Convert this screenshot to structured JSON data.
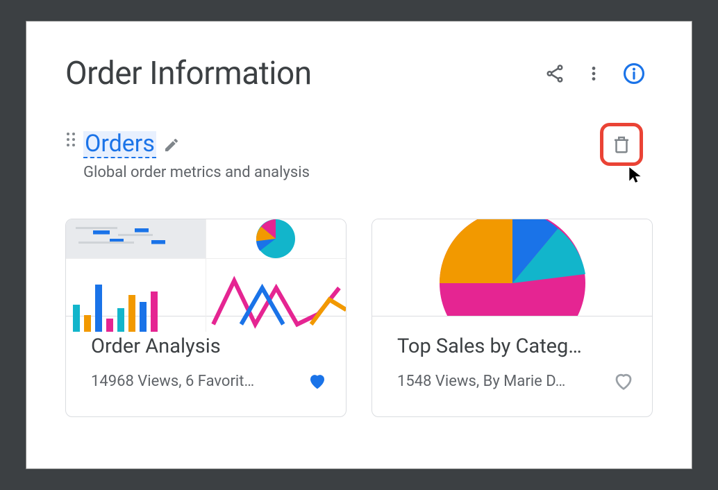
{
  "header": {
    "title": "Order Information",
    "icons": {
      "share": "share-icon",
      "more": "more-vert-icon",
      "info": "info-icon"
    }
  },
  "section": {
    "title": "Orders",
    "description": "Global order metrics and analysis",
    "delete_icon": "delete-icon",
    "edit_icon": "pencil-icon",
    "drag_icon": "drag-handle-icon"
  },
  "cards": [
    {
      "title": "Order Analysis",
      "meta": "14968 Views, 6 Favorit…",
      "favorited": true
    },
    {
      "title": "Top Sales by Categ…",
      "meta": "1548 Views, By Marie D…",
      "favorited": false
    }
  ],
  "colors": {
    "accent": "#1a73e8",
    "danger": "#ea4335",
    "gray": "#5f6368",
    "teal": "#12b5cb",
    "orange": "#f29900",
    "magenta": "#e52592"
  }
}
